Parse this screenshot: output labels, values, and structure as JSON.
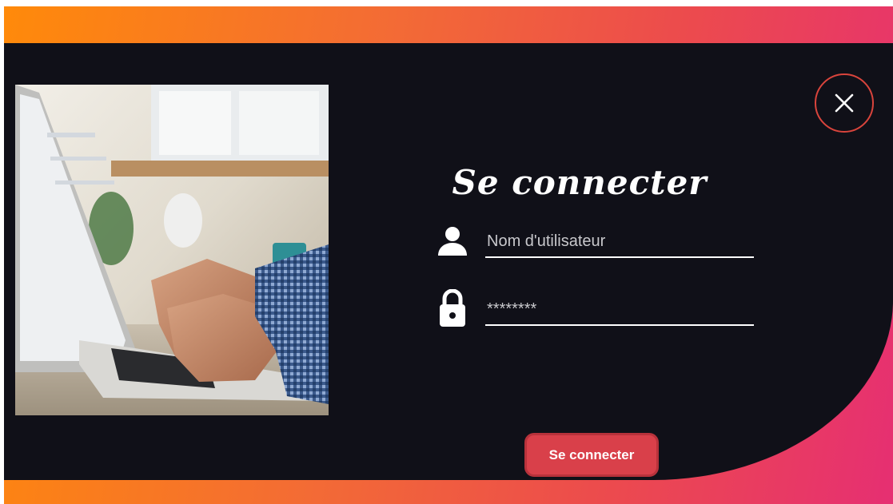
{
  "login": {
    "title": "Se connecter",
    "username": {
      "placeholder": "Nom d'utilisateur",
      "value": "",
      "icon": "user-icon"
    },
    "password": {
      "placeholder": "********",
      "value": "",
      "icon": "lock-icon"
    },
    "submit_label": "Se connecter",
    "close_icon": "close-icon"
  },
  "colors": {
    "gradient_start": "#ff8a0a",
    "gradient_end": "#e62f72",
    "panel": "#101018",
    "button": "#d9404a",
    "close_border": "#d9443c"
  }
}
